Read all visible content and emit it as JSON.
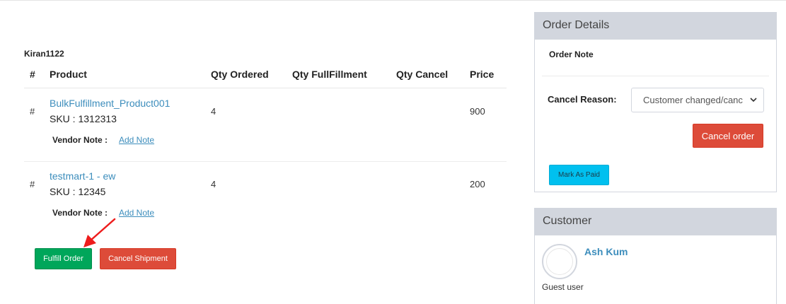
{
  "vendor": {
    "name": "Kiran1122"
  },
  "table": {
    "headers": [
      "#",
      "Product",
      "Qty Ordered",
      "Qty FullFillment",
      "Qty Cancel",
      "Price"
    ],
    "rows": [
      {
        "index": "#",
        "product": "BulkFulfillment_Product001",
        "sku": "SKU : 1312313",
        "qty_ordered": "4",
        "price": "900",
        "vendor_note_label": "Vendor Note :",
        "add_note": "Add Note"
      },
      {
        "index": "#",
        "product": "testmart-1 - ew",
        "sku": "SKU : 12345",
        "qty_ordered": "4",
        "price": "200",
        "vendor_note_label": "Vendor Note :",
        "add_note": "Add Note"
      }
    ]
  },
  "actions": {
    "fulfill": "Fulfill Order",
    "cancel_shipment": "Cancel Shipment"
  },
  "order_details": {
    "title": "Order Details",
    "order_note_label": "Order Note",
    "cancel_reason_label": "Cancel Reason:",
    "cancel_reason_value": "Customer changed/canc",
    "cancel_order": "Cancel order",
    "mark_as_paid": "Mark As Paid"
  },
  "customer": {
    "title": "Customer",
    "name": "Ash Kum",
    "type": "Guest user"
  },
  "colors": {
    "link": "#3c8dbc",
    "green": "#00a65a",
    "red": "#dd4b39",
    "aqua": "#00c0ef",
    "box_header": "#d2d6de"
  },
  "icons": {
    "arrow": "red-annotation-arrow",
    "select": "chevron-down-icon",
    "avatar": "avatar-placeholder"
  }
}
